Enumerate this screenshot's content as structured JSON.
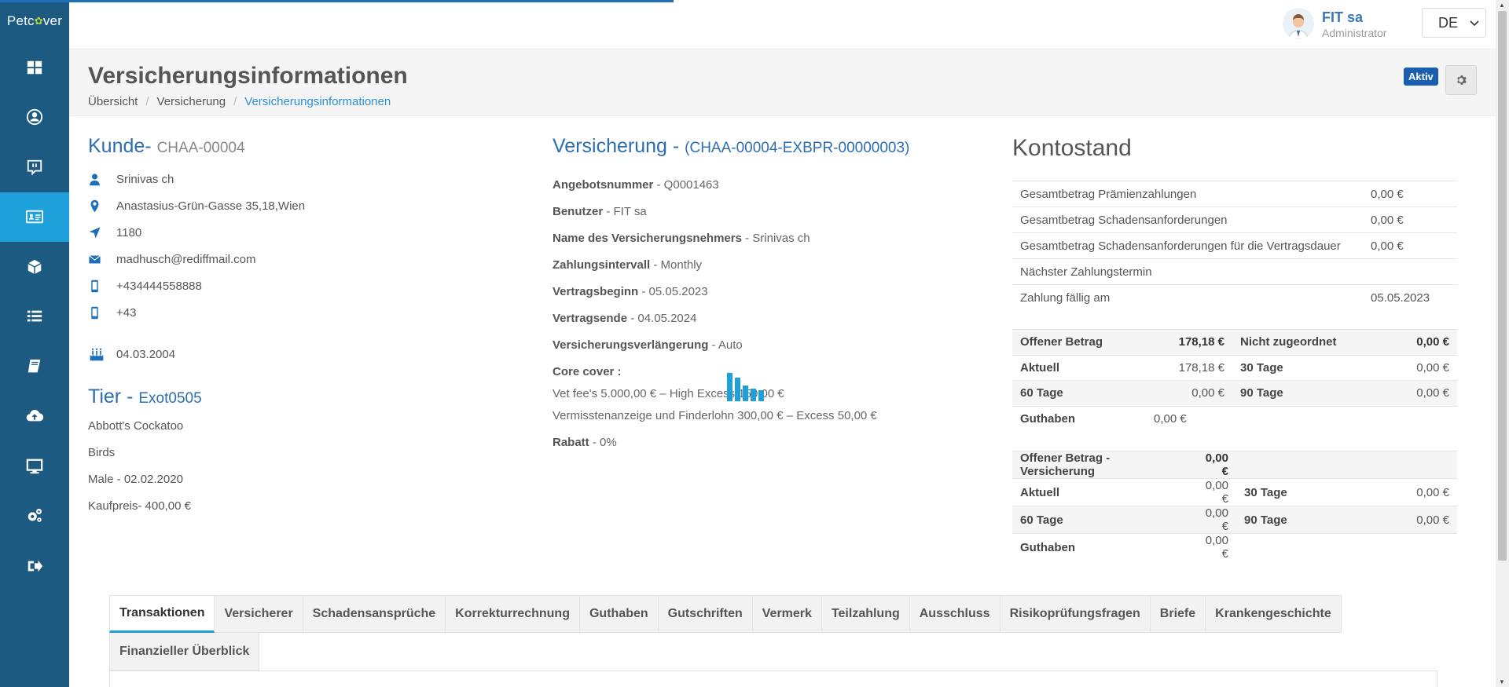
{
  "app": {
    "logo_left": "Petc",
    "logo_right": "ver"
  },
  "header": {
    "user_name": "FIT sa",
    "user_role": "Administrator",
    "language": "DE"
  },
  "sidebar": {
    "items": [
      {
        "icon": "dashboard-icon"
      },
      {
        "icon": "user-icon"
      },
      {
        "icon": "chat-icon"
      },
      {
        "icon": "id-card-icon",
        "active": true
      },
      {
        "icon": "cube-icon"
      },
      {
        "icon": "list-icon"
      },
      {
        "icon": "book-icon"
      },
      {
        "icon": "cloud-upload-icon"
      },
      {
        "icon": "monitor-icon"
      },
      {
        "icon": "gears-icon"
      },
      {
        "icon": "logout-icon"
      }
    ]
  },
  "page": {
    "title": "Versicherungsinformationen",
    "breadcrumb": [
      "Übersicht",
      "Versicherung",
      "Versicherungsinformationen"
    ],
    "status": "Aktiv"
  },
  "kunde": {
    "title": "Kunde-",
    "id": "CHAA-00004",
    "name": "Srinivas ch",
    "address": "Anastasius-Grün-Gasse 35,18,Wien",
    "zip": "1180",
    "email": "madhusch@rediffmail.com",
    "phone1": "+434444558888",
    "phone2": "+43",
    "birthdate": "04.03.2004"
  },
  "tier": {
    "title": "Tier -",
    "id": "Exot0505",
    "breed": "Abbott's Cockatoo",
    "species": "Birds",
    "gender_birth": "Male - 02.02.2020",
    "price": "Kaufpreis- 400,00 €"
  },
  "versicherung": {
    "title": "Versicherung -",
    "id": "(CHAA-00004-EXBPR-00000003)",
    "fields": [
      {
        "label": "Angebotsnummer",
        "value": "- Q0001463"
      },
      {
        "label": "Benutzer",
        "value": "- FIT sa"
      },
      {
        "label": "Name des Versicherungsnehmers",
        "value": "- Srinivas ch"
      },
      {
        "label": "Zahlungsintervall",
        "value": "- Monthly"
      },
      {
        "label": "Vertragsbeginn",
        "value": "- 05.05.2023"
      },
      {
        "label": "Vertragsende",
        "value": "- 04.05.2024"
      },
      {
        "label": "Versicherungsverlängerung",
        "value": "- Auto"
      }
    ],
    "core_cover_label": "Core cover :",
    "core_cover": [
      "Vet fee's 5.000,00 € – High Excess 150,00 €",
      "Vermisstenanzeige und Finderlohn 300,00 € – Excess 50,00 €"
    ],
    "rabatt_label": "Rabatt",
    "rabatt_value": "- 0%"
  },
  "kontostand": {
    "title": "Kontostand",
    "summary": [
      {
        "label": "Gesamtbetrag Prämienzahlungen",
        "value": "0,00 €"
      },
      {
        "label": "Gesamtbetrag Schadensanforderungen",
        "value": "0,00 €"
      },
      {
        "label": "Gesamtbetrag Schadensanforderungen für die Vertragsdauer",
        "value": "0,00 €"
      },
      {
        "label": "Nächster Zahlungstermin",
        "value": ""
      },
      {
        "label": "Zahlung fällig am",
        "value": "05.05.2023"
      }
    ],
    "offen": {
      "r1": [
        "Offener Betrag",
        "178,18 €",
        "Nicht zugeordnet",
        "0,00 €"
      ],
      "r2": [
        "Aktuell",
        "178,18 €",
        "30 Tage",
        "0,00 €"
      ],
      "r3": [
        "60 Tage",
        "0,00 €",
        "90 Tage",
        "0,00 €"
      ],
      "r4": [
        "Guthaben",
        "0,00 €"
      ]
    },
    "offen_vers": {
      "r1": [
        "Offener Betrag - Versicherung",
        "0,00 €"
      ],
      "r2": [
        "Aktuell",
        "0,00 €",
        "30 Tage",
        "0,00 €"
      ],
      "r3": [
        "60 Tage",
        "0,00 €",
        "90 Tage",
        "0,00 €"
      ],
      "r4": [
        "Guthaben",
        "0,00 €"
      ]
    }
  },
  "tabs": [
    "Transaktionen",
    "Versicherer",
    "Schadensansprüche",
    "Korrekturrechnung",
    "Guthaben",
    "Gutschriften",
    "Vermerk",
    "Teilzahlung",
    "Ausschluss",
    "Risikoprüfungsfragen",
    "Briefe",
    "Krankengeschichte",
    "Finanzieller Überblick"
  ],
  "colors": {
    "sidebar": "#1d5a82",
    "active": "#1ea1db",
    "accent": "#2d6eb0",
    "badge": "#1a5fad"
  }
}
